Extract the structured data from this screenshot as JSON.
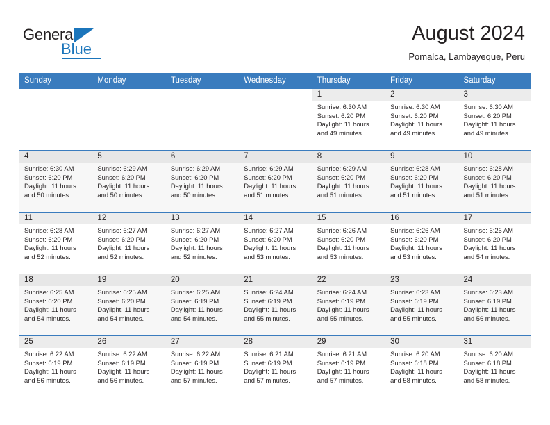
{
  "brand": {
    "name_part1": "General",
    "name_part2": "Blue",
    "triangle_icon": "triangle-icon",
    "accent_color": "#1b75bb"
  },
  "header": {
    "title": "August 2024",
    "subtitle": "Pomalca, Lambayeque, Peru"
  },
  "calendar": {
    "header_color": "#3a7cbe",
    "weekdays": [
      "Sunday",
      "Monday",
      "Tuesday",
      "Wednesday",
      "Thursday",
      "Friday",
      "Saturday"
    ],
    "weeks": [
      [
        {
          "day": "",
          "sunrise": "",
          "sunset": "",
          "daylight_line1": "",
          "daylight_line2": ""
        },
        {
          "day": "",
          "sunrise": "",
          "sunset": "",
          "daylight_line1": "",
          "daylight_line2": ""
        },
        {
          "day": "",
          "sunrise": "",
          "sunset": "",
          "daylight_line1": "",
          "daylight_line2": ""
        },
        {
          "day": "",
          "sunrise": "",
          "sunset": "",
          "daylight_line1": "",
          "daylight_line2": ""
        },
        {
          "day": "1",
          "sunrise": "Sunrise: 6:30 AM",
          "sunset": "Sunset: 6:20 PM",
          "daylight_line1": "Daylight: 11 hours",
          "daylight_line2": "and 49 minutes."
        },
        {
          "day": "2",
          "sunrise": "Sunrise: 6:30 AM",
          "sunset": "Sunset: 6:20 PM",
          "daylight_line1": "Daylight: 11 hours",
          "daylight_line2": "and 49 minutes."
        },
        {
          "day": "3",
          "sunrise": "Sunrise: 6:30 AM",
          "sunset": "Sunset: 6:20 PM",
          "daylight_line1": "Daylight: 11 hours",
          "daylight_line2": "and 49 minutes."
        }
      ],
      [
        {
          "day": "4",
          "sunrise": "Sunrise: 6:30 AM",
          "sunset": "Sunset: 6:20 PM",
          "daylight_line1": "Daylight: 11 hours",
          "daylight_line2": "and 50 minutes."
        },
        {
          "day": "5",
          "sunrise": "Sunrise: 6:29 AM",
          "sunset": "Sunset: 6:20 PM",
          "daylight_line1": "Daylight: 11 hours",
          "daylight_line2": "and 50 minutes."
        },
        {
          "day": "6",
          "sunrise": "Sunrise: 6:29 AM",
          "sunset": "Sunset: 6:20 PM",
          "daylight_line1": "Daylight: 11 hours",
          "daylight_line2": "and 50 minutes."
        },
        {
          "day": "7",
          "sunrise": "Sunrise: 6:29 AM",
          "sunset": "Sunset: 6:20 PM",
          "daylight_line1": "Daylight: 11 hours",
          "daylight_line2": "and 51 minutes."
        },
        {
          "day": "8",
          "sunrise": "Sunrise: 6:29 AM",
          "sunset": "Sunset: 6:20 PM",
          "daylight_line1": "Daylight: 11 hours",
          "daylight_line2": "and 51 minutes."
        },
        {
          "day": "9",
          "sunrise": "Sunrise: 6:28 AM",
          "sunset": "Sunset: 6:20 PM",
          "daylight_line1": "Daylight: 11 hours",
          "daylight_line2": "and 51 minutes."
        },
        {
          "day": "10",
          "sunrise": "Sunrise: 6:28 AM",
          "sunset": "Sunset: 6:20 PM",
          "daylight_line1": "Daylight: 11 hours",
          "daylight_line2": "and 51 minutes."
        }
      ],
      [
        {
          "day": "11",
          "sunrise": "Sunrise: 6:28 AM",
          "sunset": "Sunset: 6:20 PM",
          "daylight_line1": "Daylight: 11 hours",
          "daylight_line2": "and 52 minutes."
        },
        {
          "day": "12",
          "sunrise": "Sunrise: 6:27 AM",
          "sunset": "Sunset: 6:20 PM",
          "daylight_line1": "Daylight: 11 hours",
          "daylight_line2": "and 52 minutes."
        },
        {
          "day": "13",
          "sunrise": "Sunrise: 6:27 AM",
          "sunset": "Sunset: 6:20 PM",
          "daylight_line1": "Daylight: 11 hours",
          "daylight_line2": "and 52 minutes."
        },
        {
          "day": "14",
          "sunrise": "Sunrise: 6:27 AM",
          "sunset": "Sunset: 6:20 PM",
          "daylight_line1": "Daylight: 11 hours",
          "daylight_line2": "and 53 minutes."
        },
        {
          "day": "15",
          "sunrise": "Sunrise: 6:26 AM",
          "sunset": "Sunset: 6:20 PM",
          "daylight_line1": "Daylight: 11 hours",
          "daylight_line2": "and 53 minutes."
        },
        {
          "day": "16",
          "sunrise": "Sunrise: 6:26 AM",
          "sunset": "Sunset: 6:20 PM",
          "daylight_line1": "Daylight: 11 hours",
          "daylight_line2": "and 53 minutes."
        },
        {
          "day": "17",
          "sunrise": "Sunrise: 6:26 AM",
          "sunset": "Sunset: 6:20 PM",
          "daylight_line1": "Daylight: 11 hours",
          "daylight_line2": "and 54 minutes."
        }
      ],
      [
        {
          "day": "18",
          "sunrise": "Sunrise: 6:25 AM",
          "sunset": "Sunset: 6:20 PM",
          "daylight_line1": "Daylight: 11 hours",
          "daylight_line2": "and 54 minutes."
        },
        {
          "day": "19",
          "sunrise": "Sunrise: 6:25 AM",
          "sunset": "Sunset: 6:20 PM",
          "daylight_line1": "Daylight: 11 hours",
          "daylight_line2": "and 54 minutes."
        },
        {
          "day": "20",
          "sunrise": "Sunrise: 6:25 AM",
          "sunset": "Sunset: 6:19 PM",
          "daylight_line1": "Daylight: 11 hours",
          "daylight_line2": "and 54 minutes."
        },
        {
          "day": "21",
          "sunrise": "Sunrise: 6:24 AM",
          "sunset": "Sunset: 6:19 PM",
          "daylight_line1": "Daylight: 11 hours",
          "daylight_line2": "and 55 minutes."
        },
        {
          "day": "22",
          "sunrise": "Sunrise: 6:24 AM",
          "sunset": "Sunset: 6:19 PM",
          "daylight_line1": "Daylight: 11 hours",
          "daylight_line2": "and 55 minutes."
        },
        {
          "day": "23",
          "sunrise": "Sunrise: 6:23 AM",
          "sunset": "Sunset: 6:19 PM",
          "daylight_line1": "Daylight: 11 hours",
          "daylight_line2": "and 55 minutes."
        },
        {
          "day": "24",
          "sunrise": "Sunrise: 6:23 AM",
          "sunset": "Sunset: 6:19 PM",
          "daylight_line1": "Daylight: 11 hours",
          "daylight_line2": "and 56 minutes."
        }
      ],
      [
        {
          "day": "25",
          "sunrise": "Sunrise: 6:22 AM",
          "sunset": "Sunset: 6:19 PM",
          "daylight_line1": "Daylight: 11 hours",
          "daylight_line2": "and 56 minutes."
        },
        {
          "day": "26",
          "sunrise": "Sunrise: 6:22 AM",
          "sunset": "Sunset: 6:19 PM",
          "daylight_line1": "Daylight: 11 hours",
          "daylight_line2": "and 56 minutes."
        },
        {
          "day": "27",
          "sunrise": "Sunrise: 6:22 AM",
          "sunset": "Sunset: 6:19 PM",
          "daylight_line1": "Daylight: 11 hours",
          "daylight_line2": "and 57 minutes."
        },
        {
          "day": "28",
          "sunrise": "Sunrise: 6:21 AM",
          "sunset": "Sunset: 6:19 PM",
          "daylight_line1": "Daylight: 11 hours",
          "daylight_line2": "and 57 minutes."
        },
        {
          "day": "29",
          "sunrise": "Sunrise: 6:21 AM",
          "sunset": "Sunset: 6:19 PM",
          "daylight_line1": "Daylight: 11 hours",
          "daylight_line2": "and 57 minutes."
        },
        {
          "day": "30",
          "sunrise": "Sunrise: 6:20 AM",
          "sunset": "Sunset: 6:18 PM",
          "daylight_line1": "Daylight: 11 hours",
          "daylight_line2": "and 58 minutes."
        },
        {
          "day": "31",
          "sunrise": "Sunrise: 6:20 AM",
          "sunset": "Sunset: 6:18 PM",
          "daylight_line1": "Daylight: 11 hours",
          "daylight_line2": "and 58 minutes."
        }
      ]
    ]
  }
}
